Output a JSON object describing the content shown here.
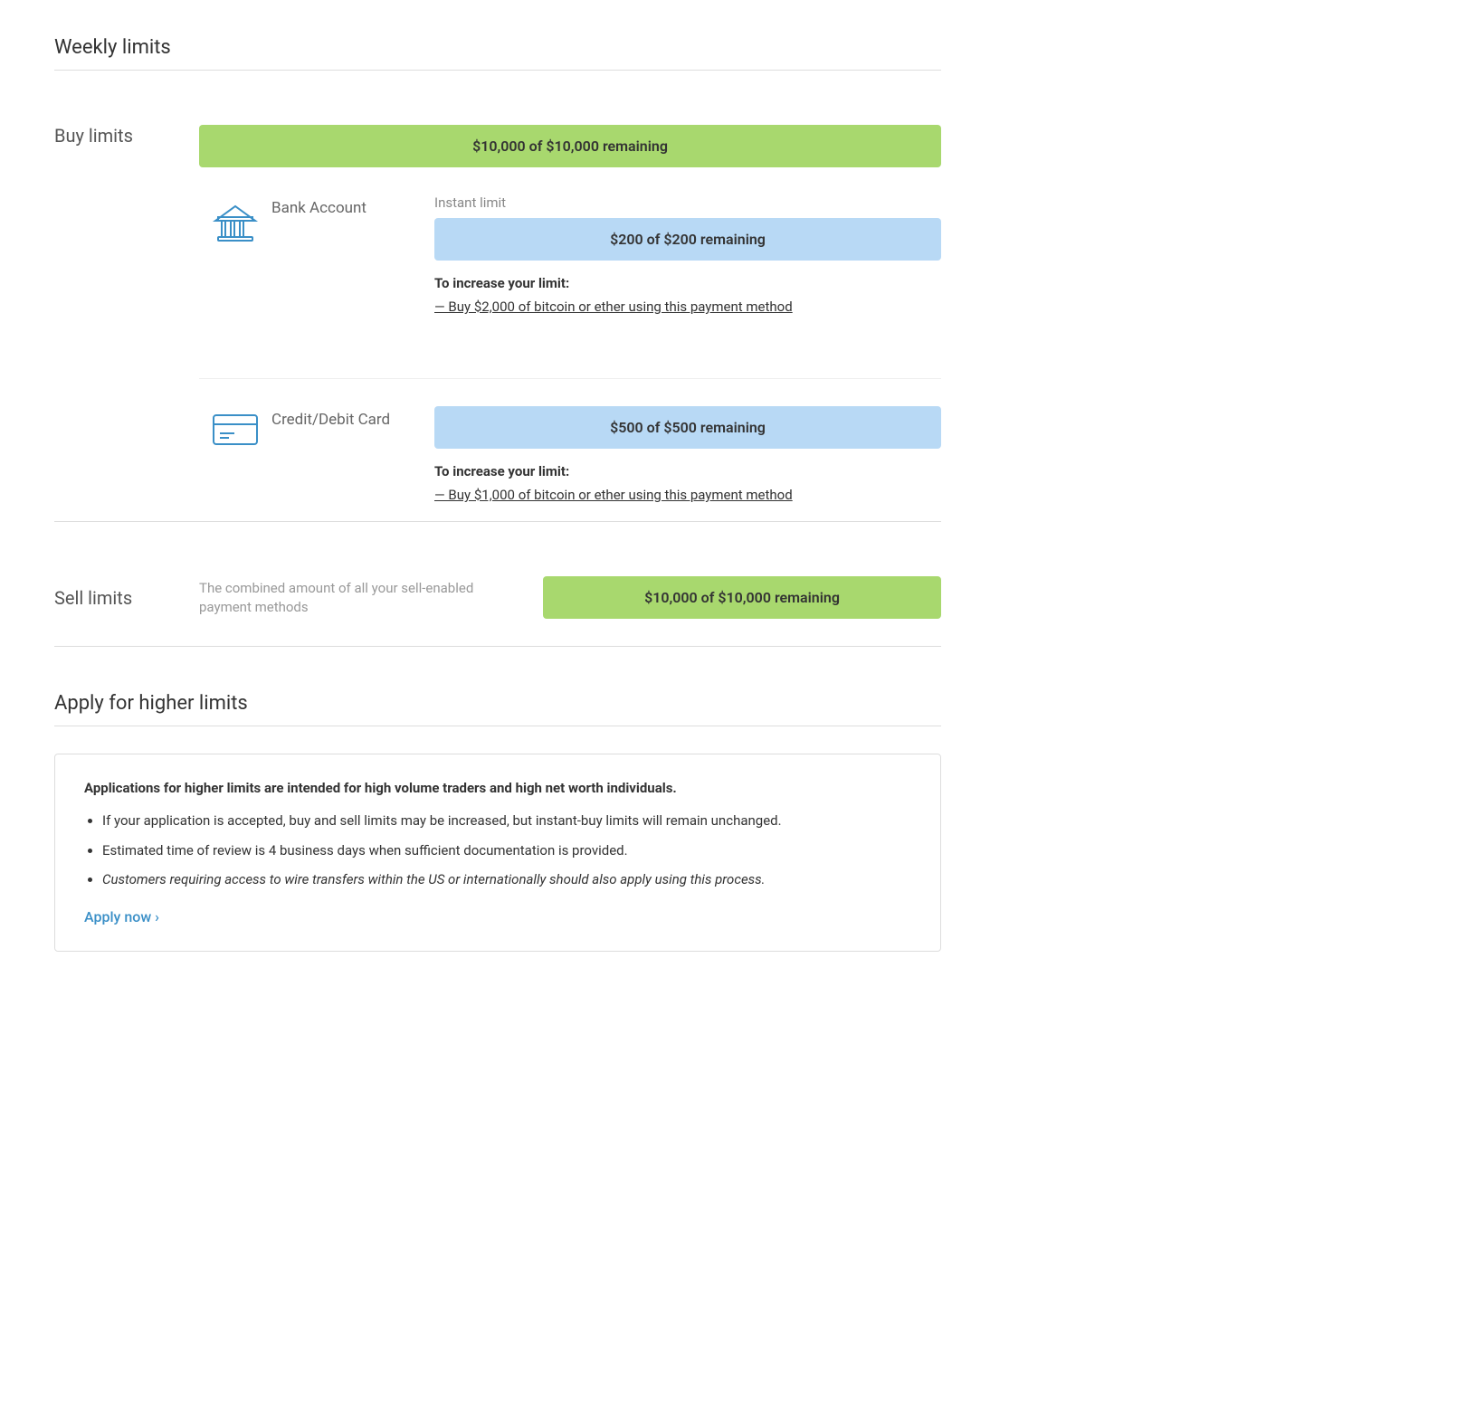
{
  "page": {
    "weekly_limits_title": "Weekly limits",
    "buy_limits_label": "Buy limits",
    "sell_limits_label": "Sell limits",
    "apply_section_title": "Apply for higher limits"
  },
  "buy_limits": {
    "overall_bar_text": "$10,000 of $10,000 remaining",
    "overall_bar_color": "#a8d86e",
    "bank_account": {
      "name": "Bank Account",
      "instant_label": "Instant limit",
      "instant_bar_text": "$200 of $200 remaining",
      "instant_bar_color": "#b8d9f5",
      "increase_title": "To increase your limit:",
      "increase_text": "— Buy $2,000 of bitcoin or ether using this payment method"
    },
    "credit_card": {
      "name": "Credit/Debit Card",
      "bar_text": "$500 of $500 remaining",
      "bar_color": "#b8d9f5",
      "increase_title": "To increase your limit:",
      "increase_text": "— Buy $1,000 of bitcoin or ether using this payment method"
    }
  },
  "sell_limits": {
    "description": "The combined amount of all your sell-enabled payment methods",
    "bar_text": "$10,000 of $10,000 remaining",
    "bar_color": "#a8d86e"
  },
  "apply_section": {
    "box_title": "Applications for higher limits are intended for high volume traders and high net worth individuals.",
    "bullet_1": "If your application is accepted, buy and sell limits may be increased, but instant-buy limits will remain unchanged.",
    "bullet_2": "Estimated time of review is 4 business days when sufficient documentation is provided.",
    "bullet_3": "Customers requiring access to wire transfers within the US or internationally should also apply using this process.",
    "apply_now_text": "Apply now ›"
  }
}
